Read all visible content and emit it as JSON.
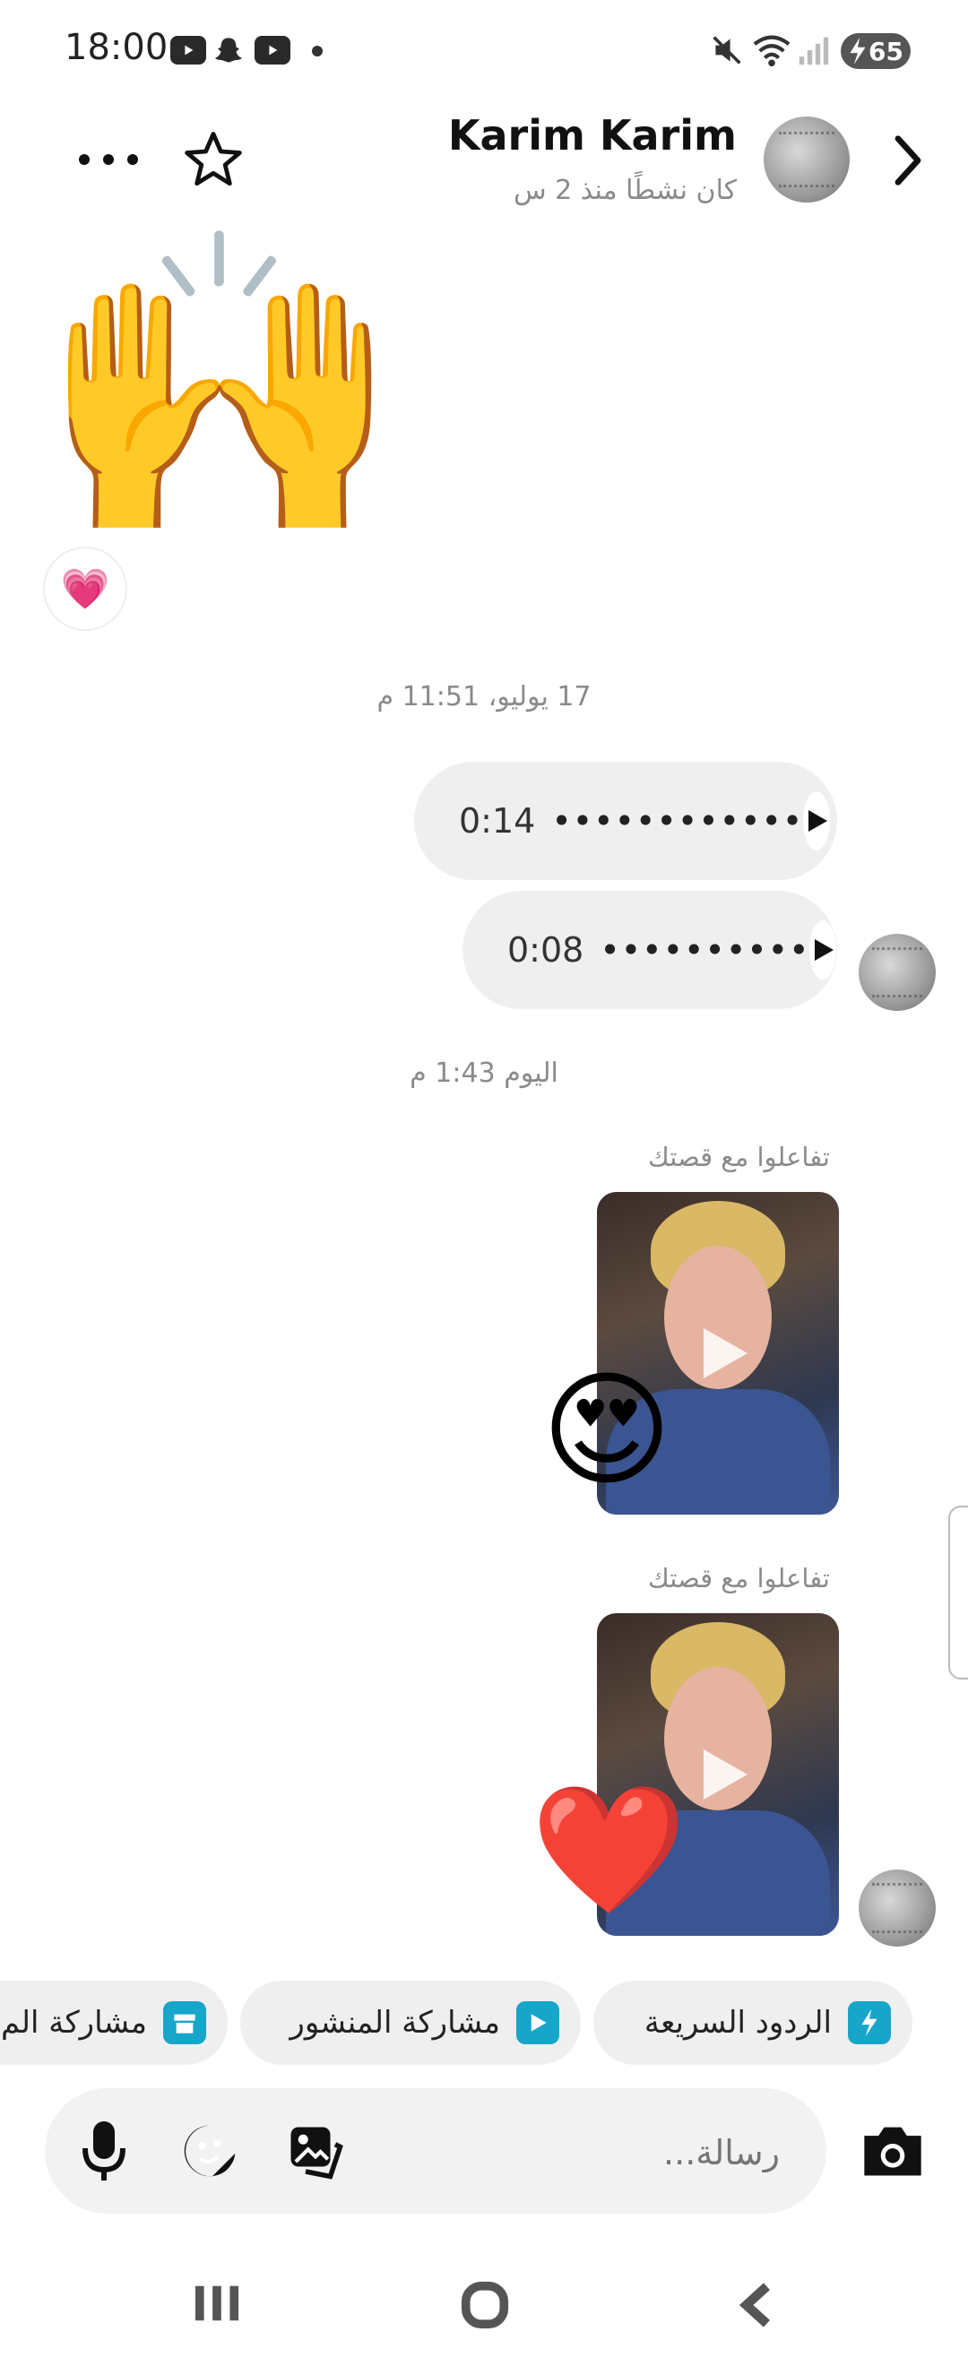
{
  "status_bar": {
    "time": "18:00",
    "battery": "65",
    "icons": [
      "youtube-icon",
      "snapchat-icon",
      "youtube-icon",
      "dot-icon",
      "mute-icon",
      "wifi-icon",
      "signal-icon",
      "battery-icon"
    ]
  },
  "header": {
    "name": "Karim Karim",
    "last_active": "كان نشطًا منذ 2 س",
    "icons": [
      "back-chevron-icon",
      "star-icon",
      "more-icon"
    ]
  },
  "chat": {
    "top_emoji": "🙌",
    "top_reaction": "💗",
    "timestamp_1": "17 يوليو، 11:51 م",
    "voice_messages": [
      {
        "duration": "0:14",
        "wave": "••••••••••••"
      },
      {
        "duration": "0:08",
        "wave": "••••••••••"
      }
    ],
    "timestamp_2": "اليوم 1:43 م",
    "story_replies": [
      {
        "label": "تفاعلوا مع قصتك",
        "reaction": "😍"
      },
      {
        "label": "تفاعلوا مع قصتك",
        "reaction": "❤️"
      }
    ]
  },
  "quick_actions": [
    {
      "label": "الردود السريعة",
      "icon": "lightning-icon",
      "color": "#17a6c9"
    },
    {
      "label": "مشاركة المنشور",
      "icon": "play-square-icon",
      "color": "#17a6c9"
    },
    {
      "label": "مشاركة الم",
      "icon": "shop-icon",
      "color": "#17a6c9"
    }
  ],
  "composer": {
    "placeholder": "رسالة..."
  },
  "colors": {
    "bubble_bg": "#efefef",
    "accent": "#17a6c9",
    "heart": "#e91e63"
  }
}
